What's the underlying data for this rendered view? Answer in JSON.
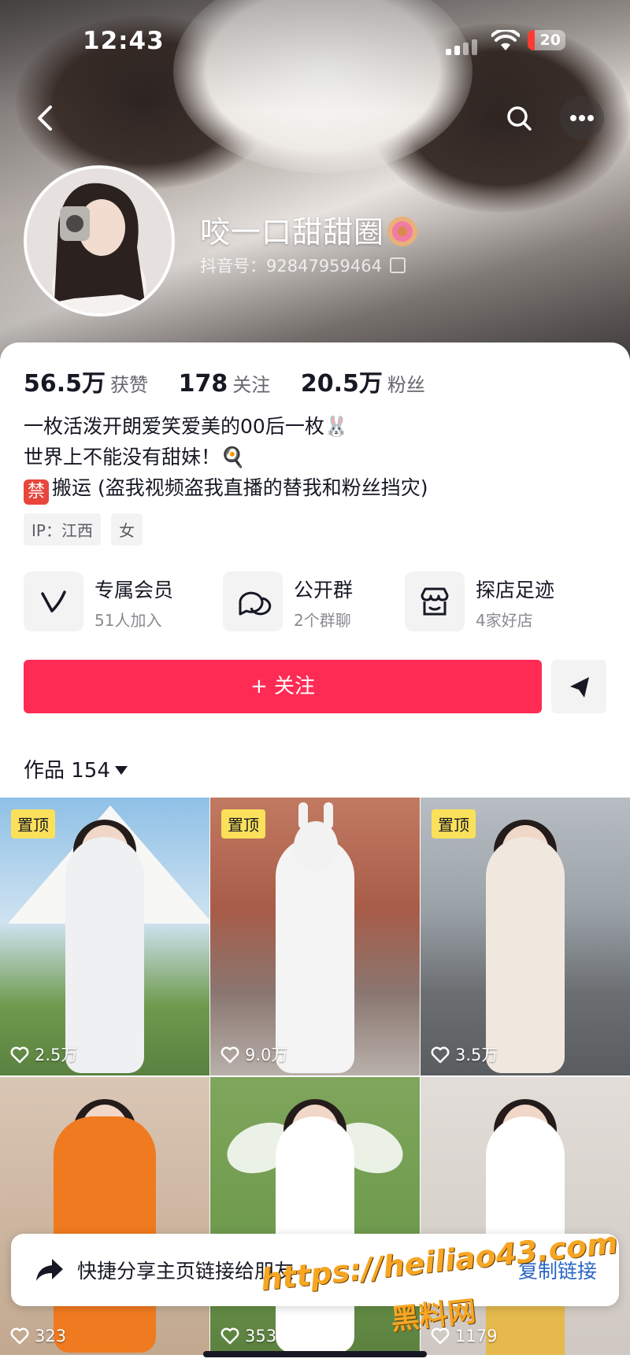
{
  "status_bar": {
    "time": "12:43",
    "battery": "20"
  },
  "profile": {
    "nickname": "咬一口甜甜圈",
    "douyin_id": "抖音号：92847959464",
    "stats": [
      {
        "value": "56.5万",
        "label": "获赞"
      },
      {
        "value": "178",
        "label": "关注"
      },
      {
        "value": "20.5万",
        "label": "粉丝"
      }
    ],
    "bio": [
      "一枚活泼开朗爱笑爱美的00后一枚🐰",
      "世界上不能没有甜妹！🍳",
      "搬运 (盗我视频盗我直播的替我和粉丝挡灾)"
    ],
    "ban_badge": "禁",
    "tags": [
      "IP：江西",
      "女"
    ]
  },
  "entries": [
    {
      "title": "专属会员",
      "subtitle": "51人加入",
      "icon": "v-badge-icon"
    },
    {
      "title": "公开群",
      "subtitle": "2个群聊",
      "icon": "group-chat-icon"
    },
    {
      "title": "探店足迹",
      "subtitle": "4家好店",
      "icon": "shop-icon"
    }
  ],
  "follow_label": "+ 关注",
  "works": {
    "label": "作品 154"
  },
  "videos": [
    {
      "pinned": "置顶",
      "likes": "2.5万",
      "bg": "#7fb0d8"
    },
    {
      "pinned": "置顶",
      "likes": "9.0万",
      "bg": "#a8614f"
    },
    {
      "pinned": "置顶",
      "likes": "3.5万",
      "bg": "#8e9aa3"
    },
    {
      "pinned": "",
      "likes": "323",
      "bg": "#c9b7a8"
    },
    {
      "pinned": "",
      "likes": "353",
      "bg": "#6f9a55"
    },
    {
      "pinned": "",
      "likes": "1179",
      "bg": "#d8d2cc"
    }
  ],
  "share_bar": {
    "text": "快捷分享主页链接给朋友",
    "action": "复制链接"
  },
  "watermark": {
    "url": "https://heiliao43.com",
    "name": "黑料网"
  }
}
